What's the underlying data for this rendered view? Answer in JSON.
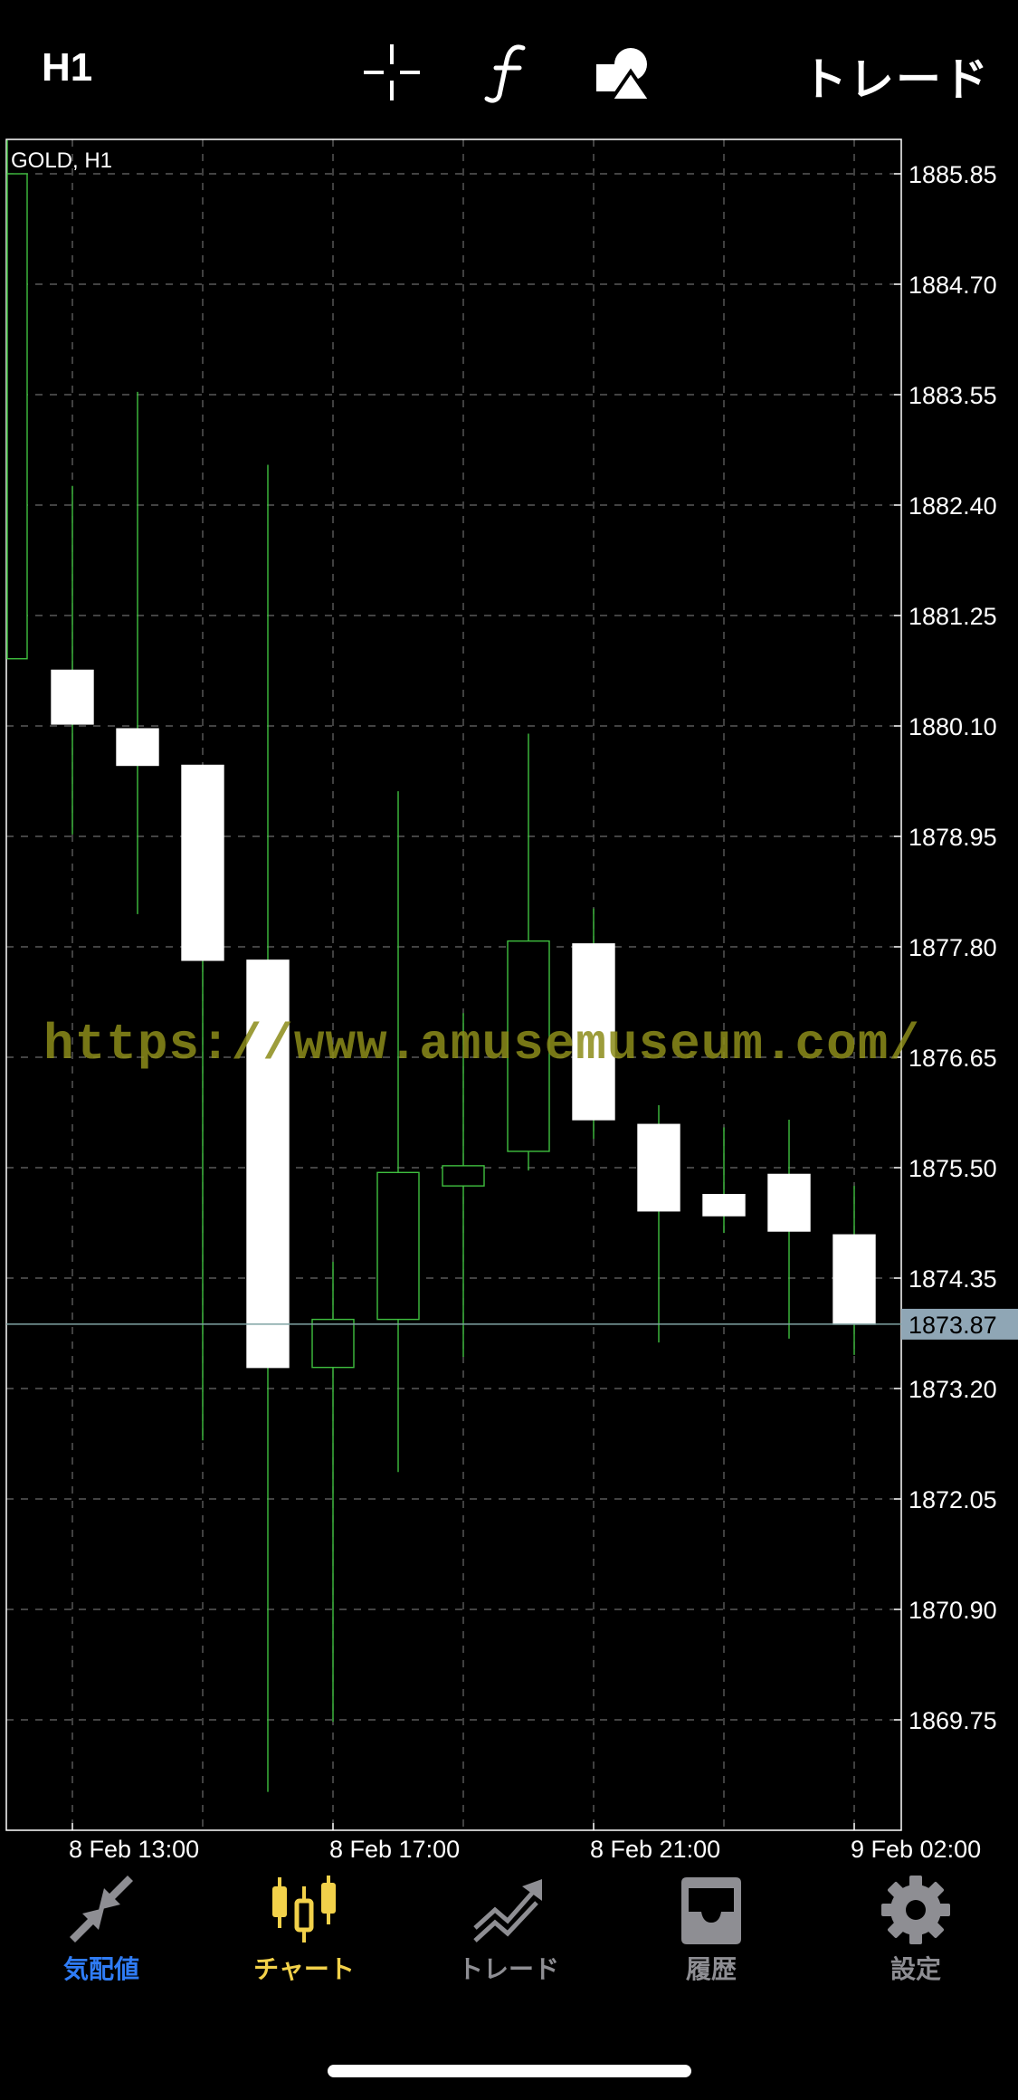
{
  "topbar": {
    "timeframe": "H1",
    "crosshair_icon": "crosshair-icon",
    "indicator_icon": "function-icon",
    "objects_icon": "shapes-icon",
    "trade_label": "トレード"
  },
  "chart": {
    "symbol_label": "GOLD, H1",
    "current_price": "1873.87",
    "watermark": "https://www.amusemuseum.com/",
    "colors": {
      "background": "#000000",
      "frame": "#ffffff",
      "grid": "#6b6b6b",
      "bull_body": "#000000",
      "bull_outline": "#3fbf3f",
      "bear_body": "#ffffff",
      "wick": "#3fbf3f",
      "price_badge": "#8fa6b5",
      "price_line": "#7fa3a3"
    }
  },
  "chart_data": {
    "type": "candlestick",
    "title": "GOLD, H1",
    "ylim": [
      1868.65,
      1886.2
    ],
    "y_ticks": [
      "1885.85",
      "1884.70",
      "1883.55",
      "1882.40",
      "1881.25",
      "1880.10",
      "1878.95",
      "1877.80",
      "1876.65",
      "1875.50",
      "1874.35",
      "1873.20",
      "1872.05",
      "1870.90",
      "1869.75"
    ],
    "x_tick_labels": [
      "8 Feb 13:00",
      "8 Feb 17:00",
      "8 Feb 21:00",
      "9 Feb 02:00"
    ],
    "grid": true,
    "candles": [
      {
        "open": 1880.8,
        "high": 1886.2,
        "low": 1880.8,
        "close": 1885.85
      },
      {
        "open": 1880.68,
        "high": 1882.6,
        "low": 1878.97,
        "close": 1880.12
      },
      {
        "open": 1880.07,
        "high": 1883.58,
        "low": 1878.14,
        "close": 1879.69
      },
      {
        "open": 1879.69,
        "high": 1879.69,
        "low": 1872.66,
        "close": 1877.66
      },
      {
        "open": 1877.66,
        "high": 1882.82,
        "low": 1869.0,
        "close": 1873.42
      },
      {
        "open": 1873.42,
        "high": 1874.52,
        "low": 1869.73,
        "close": 1873.92
      },
      {
        "open": 1873.92,
        "high": 1879.42,
        "low": 1872.33,
        "close": 1875.45
      },
      {
        "open": 1875.31,
        "high": 1877.11,
        "low": 1873.53,
        "close": 1875.52
      },
      {
        "open": 1875.67,
        "high": 1880.02,
        "low": 1875.47,
        "close": 1877.86
      },
      {
        "open": 1877.83,
        "high": 1878.2,
        "low": 1875.8,
        "close": 1876.0
      },
      {
        "open": 1875.95,
        "high": 1876.15,
        "low": 1873.68,
        "close": 1875.05
      },
      {
        "open": 1875.22,
        "high": 1875.92,
        "low": 1874.82,
        "close": 1875.0
      },
      {
        "open": 1875.43,
        "high": 1876.0,
        "low": 1873.72,
        "close": 1874.84
      },
      {
        "open": 1874.8,
        "high": 1875.31,
        "low": 1873.55,
        "close": 1873.87
      }
    ],
    "current_price": 1873.87
  },
  "tabbar": {
    "tabs": [
      {
        "label": "気配値",
        "icon": "quotes-arrows-icon",
        "color": "#2f7cf6"
      },
      {
        "label": "チャート",
        "icon": "candles-icon",
        "color": "#f2d14a"
      },
      {
        "label": "トレード",
        "icon": "trade-trend-icon",
        "color": "#8e8e93"
      },
      {
        "label": "履歴",
        "icon": "history-inbox-icon",
        "color": "#8e8e93"
      },
      {
        "label": "設定",
        "icon": "settings-gear-icon",
        "color": "#8e8e93"
      }
    ]
  }
}
